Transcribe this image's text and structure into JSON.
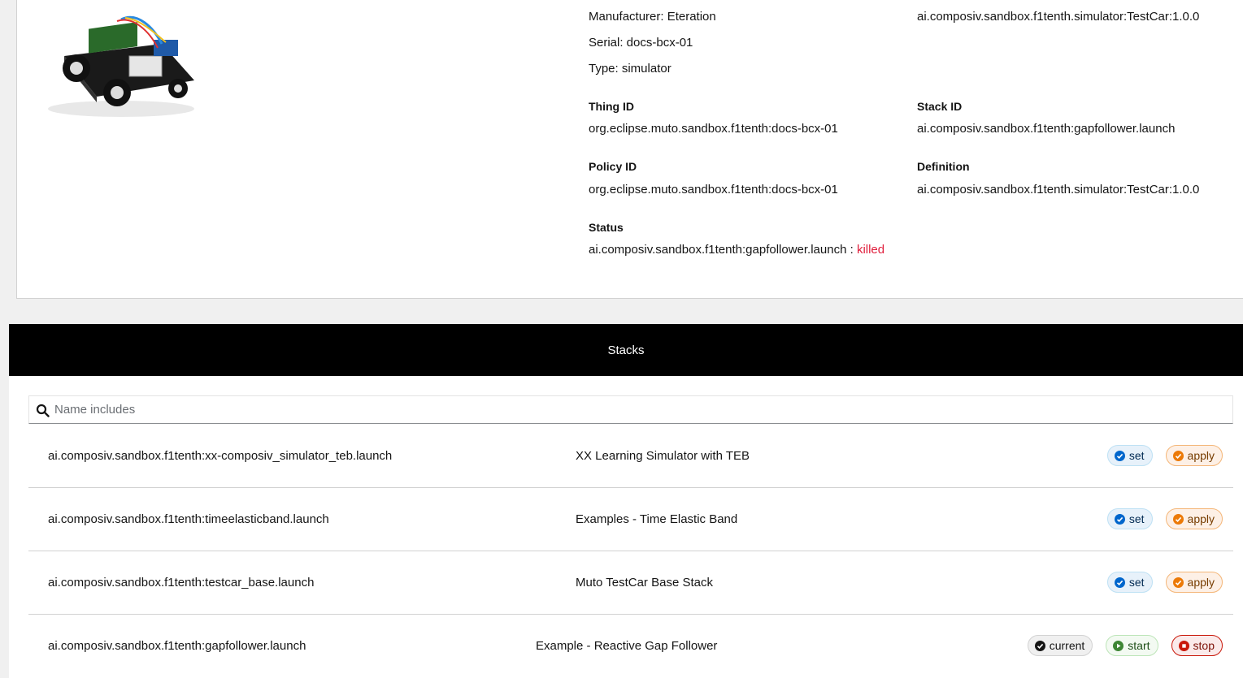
{
  "device": {
    "image_alt": "TestCar robot",
    "manufacturer": "Manufacturer: Eteration",
    "serial": "Serial: docs-bcx-01",
    "type": "Type: simulator",
    "model": "ai.composiv.sandbox.f1tenth.simulator:TestCar:1.0.0",
    "thing_id_label": "Thing ID",
    "thing_id": "org.eclipse.muto.sandbox.f1tenth:docs-bcx-01",
    "stack_id_label": "Stack ID",
    "stack_id": "ai.composiv.sandbox.f1tenth:gapfollower.launch",
    "policy_id_label": "Policy ID",
    "policy_id": "org.eclipse.muto.sandbox.f1tenth:docs-bcx-01",
    "definition_label": "Definition",
    "definition": "ai.composiv.sandbox.f1tenth.simulator:TestCar:1.0.0",
    "status_label": "Status",
    "status_stack": "ai.composiv.sandbox.f1tenth:gapfollower.launch :",
    "status_value": "killed"
  },
  "stacks": {
    "title": "Stacks",
    "search_placeholder": "Name includes",
    "rows": [
      {
        "name": "ai.composiv.sandbox.f1tenth:xx-composiv_simulator_teb.launch",
        "description": "XX Learning Simulator with TEB",
        "actions": [
          "set",
          "apply"
        ]
      },
      {
        "name": "ai.composiv.sandbox.f1tenth:timeelasticband.launch",
        "description": "Examples - Time Elastic Band",
        "actions": [
          "set",
          "apply"
        ]
      },
      {
        "name": "ai.composiv.sandbox.f1tenth:testcar_base.launch",
        "description": "Muto TestCar Base Stack",
        "actions": [
          "set",
          "apply"
        ]
      },
      {
        "name": "ai.composiv.sandbox.f1tenth:gapfollower.launch",
        "description": "Example - Reactive Gap Follower",
        "actions": [
          "current",
          "start",
          "stop"
        ]
      }
    ]
  },
  "colors": {
    "header_bg": "#000000",
    "killed": "#e01e3c",
    "set": "#0066cc",
    "apply": "#ec7a08",
    "start": "#3e8635",
    "stop": "#c9190b"
  }
}
